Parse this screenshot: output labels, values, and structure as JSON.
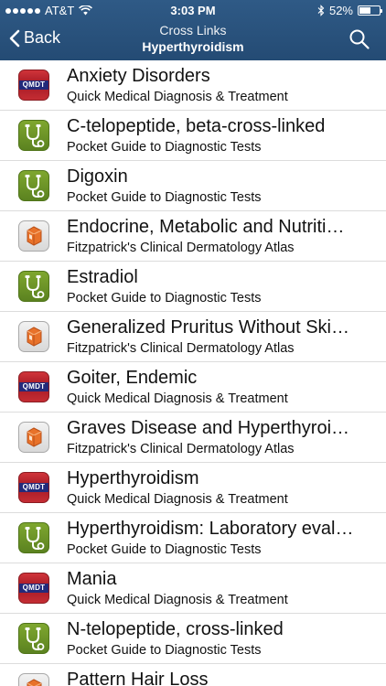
{
  "status_bar": {
    "carrier": "AT&T",
    "time": "3:03 PM",
    "battery": "52%",
    "battery_level": 0.52
  },
  "nav": {
    "back_label": "Back",
    "title": "Cross Links",
    "subtitle": "Hyperthyroidism"
  },
  "items": [
    {
      "title": "Anxiety Disorders",
      "source": "Quick Medical Diagnosis & Treatment",
      "icon": "qmdt-icon"
    },
    {
      "title": "C-telopeptide, beta-cross-linked",
      "source": "Pocket Guide to Diagnostic Tests",
      "icon": "pocket-guide-icon"
    },
    {
      "title": "Digoxin",
      "source": "Pocket Guide to Diagnostic Tests",
      "icon": "pocket-guide-icon"
    },
    {
      "title": "Endocrine, Metabolic and Nutriti…",
      "source": "Fitzpatrick's Clinical Dermatology Atlas",
      "icon": "fitzpatrick-icon"
    },
    {
      "title": "Estradiol",
      "source": "Pocket Guide to Diagnostic Tests",
      "icon": "pocket-guide-icon"
    },
    {
      "title": "Generalized Pruritus Without Ski…",
      "source": "Fitzpatrick's Clinical Dermatology Atlas",
      "icon": "fitzpatrick-icon"
    },
    {
      "title": "Goiter, Endemic",
      "source": "Quick Medical Diagnosis & Treatment",
      "icon": "qmdt-icon"
    },
    {
      "title": "Graves Disease and Hyperthyroi…",
      "source": "Fitzpatrick's Clinical Dermatology Atlas",
      "icon": "fitzpatrick-icon"
    },
    {
      "title": "Hyperthyroidism",
      "source": "Quick Medical Diagnosis & Treatment",
      "icon": "qmdt-icon"
    },
    {
      "title": "Hyperthyroidism: Laboratory eval…",
      "source": "Pocket Guide to Diagnostic Tests",
      "icon": "pocket-guide-icon"
    },
    {
      "title": "Mania",
      "source": "Quick Medical Diagnosis & Treatment",
      "icon": "qmdt-icon"
    },
    {
      "title": "N-telopeptide, cross-linked",
      "source": "Pocket Guide to Diagnostic Tests",
      "icon": "pocket-guide-icon"
    },
    {
      "title": "Pattern Hair Loss",
      "source": "",
      "icon": "fitzpatrick-icon"
    }
  ],
  "icon_labels": {
    "qmdt": "QMDT"
  },
  "colors": {
    "nav_bar": "#2b5580",
    "qmdt_red": "#c52d33",
    "qmdt_navy": "#232a7a",
    "pocket_green": "#6e9a28"
  }
}
